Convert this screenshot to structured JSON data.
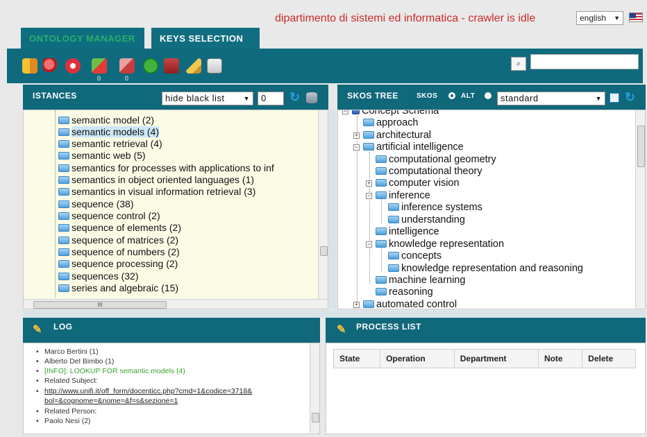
{
  "header": {
    "title": "dipartimento di sistemi ed informatica - crawler is idle",
    "language": "english"
  },
  "tabs": [
    {
      "label": "ONTOLOGY MANAGER"
    },
    {
      "label": "KEYS SELECTION"
    }
  ],
  "toolbar": {
    "badge_1": "0",
    "badge_2": "0",
    "search_button": "⌕",
    "search_value": ""
  },
  "istances": {
    "title": "ISTANCES",
    "filter": "hide black list",
    "count": "0",
    "items": [
      "semantic model (2)",
      "semantic models (4)",
      "semantic retrieval (4)",
      "semantic web (5)",
      "semantics for processes with applications to inf",
      "semantics in object oriented languages (1)",
      "semantics in visual information retrieval (3)",
      "sequence (38)",
      "sequence control (2)",
      "sequence of elements (2)",
      "sequence of matrices (2)",
      "sequence of numbers (2)",
      "sequence processing (2)",
      "sequences (32)",
      "series and algebraic (15)"
    ],
    "hscroll_label": "III"
  },
  "skos": {
    "title": "SKOS TREE",
    "option_skos": "SKOS",
    "option_alt": "ALT",
    "scheme": "standard",
    "items": [
      {
        "label": "Concept Schema"
      },
      {
        "label": "approach"
      },
      {
        "label": "architectural"
      },
      {
        "label": "artificial intelligence"
      },
      {
        "label": "computational geometry"
      },
      {
        "label": "computational theory"
      },
      {
        "label": "computer vision"
      },
      {
        "label": "inference"
      },
      {
        "label": "inference systems"
      },
      {
        "label": "understanding"
      },
      {
        "label": "intelligence"
      },
      {
        "label": "knowledge representation"
      },
      {
        "label": "concepts"
      },
      {
        "label": "knowledge representation and reasoning"
      },
      {
        "label": "machine learning"
      },
      {
        "label": "reasoning"
      },
      {
        "label": "automated control"
      }
    ]
  },
  "log": {
    "title": "LOG",
    "lines": [
      "Marco Bertini (1)",
      "Alberto Del Bimbo (1)",
      "[INFO]: LOOKUP FOR semantic models (4)",
      "Related Subject:",
      "http://www.unifi.it/off_form/docenticc.php?cmd=1&codice=3718&",
      "bol=&cognome=&nome=&f=s&sezione=1",
      "Related Person:",
      "Paolo Nesi (2)"
    ]
  },
  "process": {
    "title": "PROCESS LIST",
    "columns": [
      "State",
      "Operation",
      "Department",
      "Note",
      "Delete"
    ]
  },
  "colors": {
    "accent": "#10687b",
    "title_red": "#cc2a2a",
    "tab_inactive_text": "#2cae6d",
    "info_green": "#3aa330"
  }
}
